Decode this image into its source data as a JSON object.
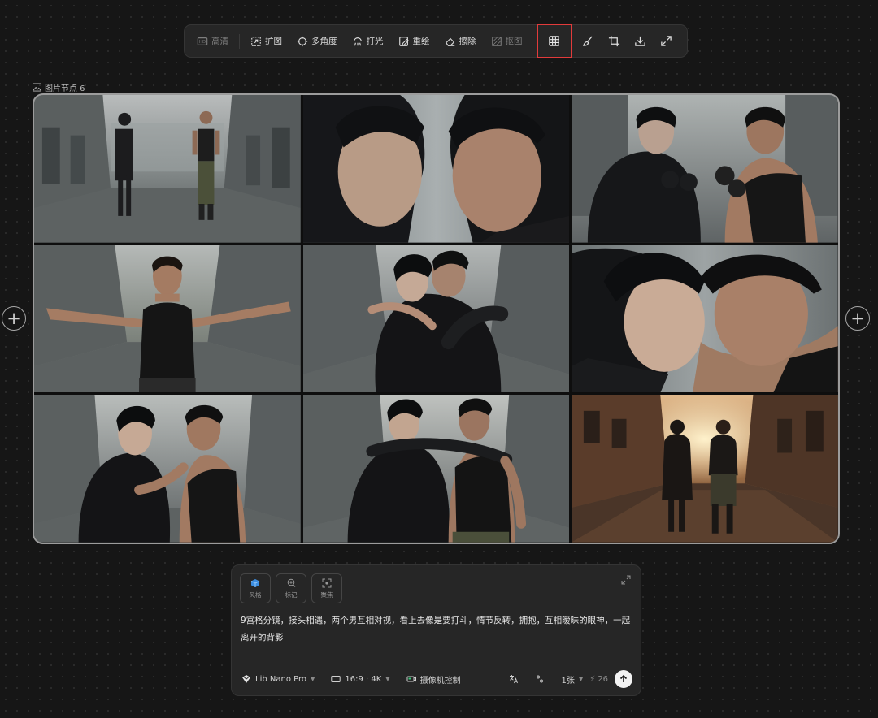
{
  "toolbar": {
    "items": [
      {
        "label": "高清",
        "icon": "hd-icon",
        "dim": true
      },
      {
        "label": "扩图",
        "icon": "expand-image-icon"
      },
      {
        "label": "多角度",
        "icon": "multi-angle-icon"
      },
      {
        "label": "打光",
        "icon": "lighting-icon"
      },
      {
        "label": "重绘",
        "icon": "redraw-icon"
      },
      {
        "label": "擦除",
        "icon": "eraser-icon"
      },
      {
        "label": "抠图",
        "icon": "cutout-icon",
        "dim": true
      }
    ],
    "highlight_color": "#e23b3b"
  },
  "node": {
    "label": "图片节点 6",
    "border_color": "#9c9c9c"
  },
  "panels": [
    {
      "scene": "Two men walking toward each other on a deserted urban street"
    },
    {
      "scene": "Close-up face-off, two men staring at each other"
    },
    {
      "scene": "Two men raising fists, about to fight"
    },
    {
      "scene": "Muscular man with arms spread wide"
    },
    {
      "scene": "Two men embracing in a hug"
    },
    {
      "scene": "Two men touching foreheads, smiling"
    },
    {
      "scene": "Two men laughing, arm around shoulder"
    },
    {
      "scene": "Two men walking side by side, arms around each other"
    },
    {
      "scene": "Back view of two men walking into sunset"
    }
  ],
  "prompt": {
    "chips": [
      {
        "label": "风格",
        "icon": "style-cube-icon"
      },
      {
        "label": "标记",
        "icon": "mark-icon"
      },
      {
        "label": "聚焦",
        "icon": "focus-icon"
      }
    ],
    "text": "9宫格分镜，接头相遇，两个男互相对视，看上去像是要打斗，情节反转，拥抱，互相暧昧的眼神，一起离开的背影",
    "model": "Lib Nano Pro",
    "aspect": "16:9 · 4K",
    "camera_control": "摄像机控制",
    "count": "1张",
    "credits": "26"
  },
  "colors": {
    "background": "#161616",
    "panel_bg": "#262626",
    "text": "#e6e6e6"
  }
}
